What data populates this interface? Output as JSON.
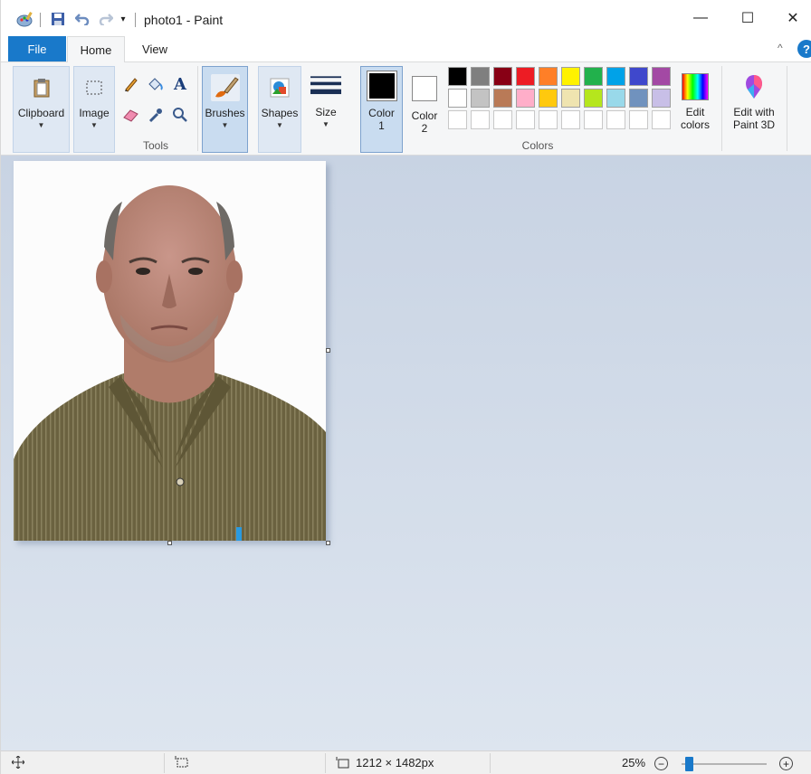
{
  "window": {
    "title": "photo1 - Paint",
    "minimize": "—",
    "maximize": "☐",
    "close": "✕"
  },
  "tabs": {
    "file": "File",
    "home": "Home",
    "view": "View",
    "collapse": "^",
    "help": "?"
  },
  "ribbon": {
    "clipboard": "Clipboard",
    "image": "Image",
    "tools_group": "Tools",
    "brushes": "Brushes",
    "shapes": "Shapes",
    "size": "Size",
    "color1": [
      "Color",
      "1"
    ],
    "color2": [
      "Color",
      "2"
    ],
    "colors_group": "Colors",
    "edit_colors": [
      "Edit",
      "colors"
    ],
    "paint3d": [
      "Edit with",
      "Paint 3D"
    ],
    "text_tool": "A",
    "color1_value": "#000000",
    "color2_value": "#ffffff",
    "palette_row1": [
      "#000000",
      "#7f7f7f",
      "#880015",
      "#ed1c24",
      "#ff7f27",
      "#fff200",
      "#22b14c",
      "#00a2e8",
      "#3f48cc",
      "#a349a4"
    ],
    "palette_row2": [
      "#ffffff",
      "#c3c3c3",
      "#b97a57",
      "#ffaec9",
      "#ffc90e",
      "#efe4b0",
      "#b5e61d",
      "#99d9ea",
      "#7092be",
      "#c8bfe7"
    ]
  },
  "status": {
    "image_size": "1212 × 1482px",
    "zoom": "25%",
    "zoom_level": 0.25,
    "zoom_out": "−",
    "zoom_in": "+"
  },
  "icons": [
    "paint-app-icon",
    "save-icon",
    "undo-icon",
    "redo-icon",
    "customize-icon",
    "pencil-icon",
    "fill-icon",
    "text-icon",
    "eraser-icon",
    "color-picker-icon",
    "magnifier-icon",
    "move-icon",
    "selection-size-icon",
    "canvas-size-icon"
  ]
}
